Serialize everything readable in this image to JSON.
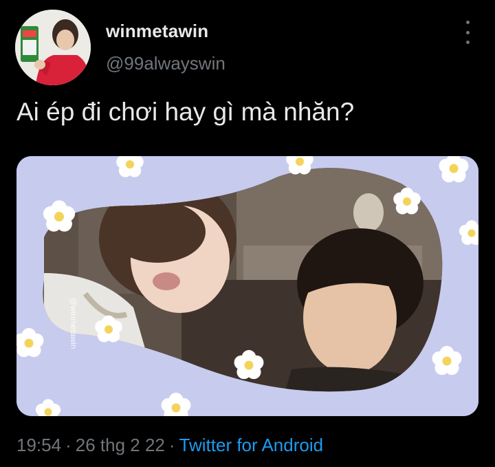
{
  "author": {
    "display_name": "winmetawin",
    "handle": "@99alwayswin"
  },
  "tweet": {
    "text": "Ai ép đi chơi hay gì mà nhăn?"
  },
  "media": {
    "watermark": "@winmetawin",
    "background_color": "#c7cbee",
    "flower_color": "#ffffff",
    "flower_center_color": "#f3d35a"
  },
  "meta": {
    "time": "19:54",
    "separator": "·",
    "date": "26 thg 2 22",
    "source": "Twitter for Android",
    "source_color": "#1d9bf0"
  },
  "icons": {
    "more": "more-vertical-icon"
  }
}
